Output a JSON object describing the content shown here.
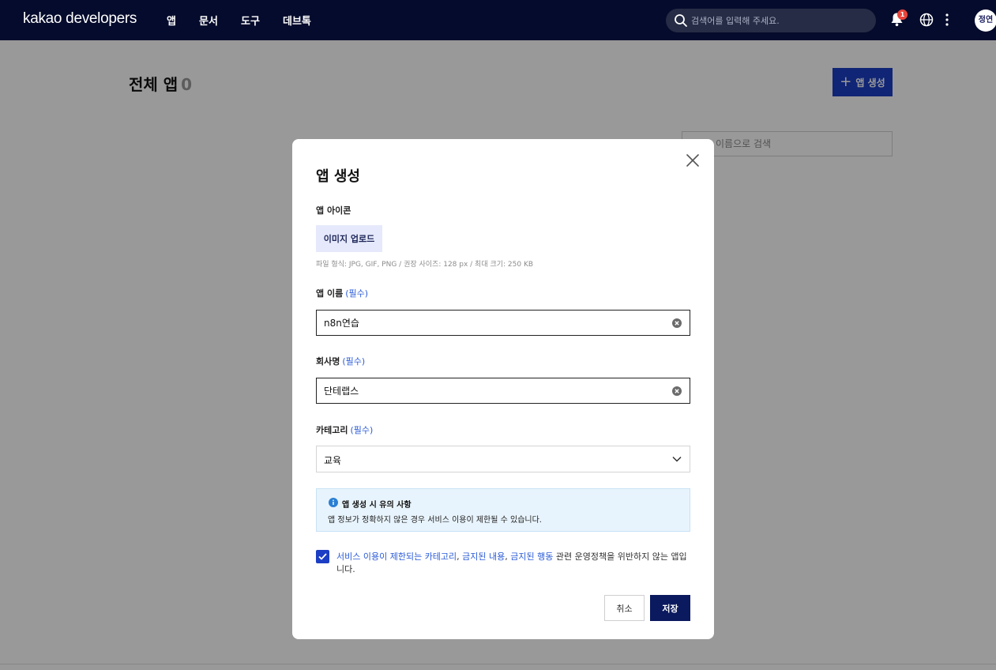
{
  "header": {
    "logo": "kakao developers",
    "nav": [
      "앱",
      "문서",
      "도구",
      "데브톡"
    ],
    "search_placeholder": "검색어를 입력해 주세요.",
    "notification_count": "1",
    "avatar_text": "정연"
  },
  "page": {
    "title": "전체 앱",
    "count": "0",
    "create_button": "앱 생성",
    "name_search_placeholder": "이름으로 검색"
  },
  "modal": {
    "title": "앱 생성",
    "icon_label": "앱 아이콘",
    "upload_button": "이미지 업로드",
    "file_help": "파일 형식: JPG, GIF, PNG / 권장 사이즈: 128 px / 최대 크기: 250 KB",
    "app_name_label": "앱 이름",
    "required": "(필수)",
    "app_name_value": "n8n연습",
    "company_label": "회사명",
    "company_value": "단테랩스",
    "category_label": "카테고리",
    "category_value": "교육",
    "notice_title": "앱 생성 시 유의 사항",
    "notice_text": "앱 정보가 정확하지 않은 경우 서비스 이용이 제한될 수 있습니다.",
    "agree": {
      "link1": "서비스 이용이 제한되는 카테고리",
      "sep1": ", ",
      "link2": "금지된 내용",
      "sep2": ", ",
      "link3": "금지된 행동",
      "rest": " 관련 운영정책을 위반하지 않는 앱입니다."
    },
    "agree_checked": true,
    "cancel_button": "취소",
    "save_button": "저장"
  },
  "colors": {
    "nav_bg": "#050b2c",
    "primary": "#1c3ec4",
    "save_bg": "#0b1a5e",
    "link": "#2a5bd7",
    "notice_bg": "#e8f4fd",
    "badge": "#e8453c"
  }
}
